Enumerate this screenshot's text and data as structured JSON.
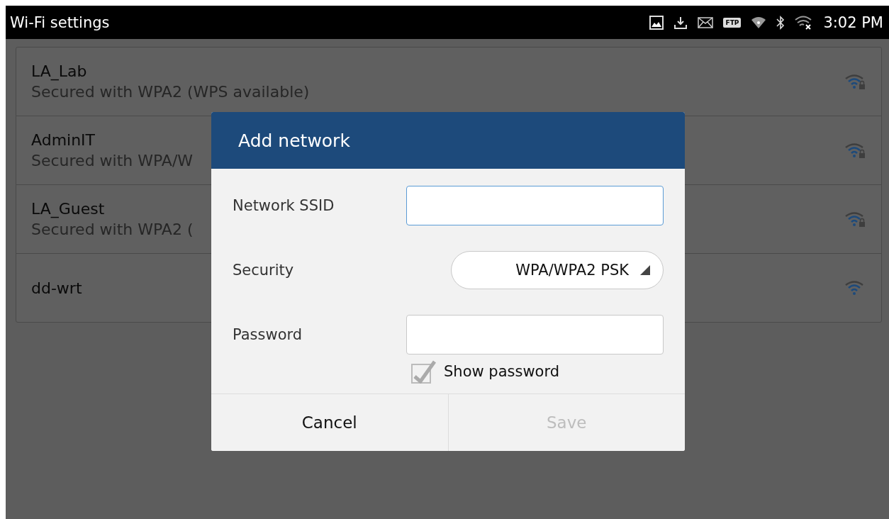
{
  "status_bar": {
    "title": "Wi-Fi settings",
    "ftp_badge": "FTP",
    "time": "3:02 PM"
  },
  "networks": [
    {
      "name": "LA_Lab",
      "detail": "Secured with WPA2 (WPS available)",
      "secured": true
    },
    {
      "name": "AdminIT",
      "detail": "Secured with WPA/W",
      "secured": true
    },
    {
      "name": "LA_Guest",
      "detail": "Secured with WPA2 (",
      "secured": true
    },
    {
      "name": "dd-wrt",
      "secured": false
    }
  ],
  "dialog": {
    "title": "Add network",
    "fields": [
      {
        "kind": "text",
        "label": "Network SSID",
        "focused": true
      },
      {
        "kind": "select",
        "label": "Security",
        "value": "WPA/WPA2 PSK"
      },
      {
        "kind": "text",
        "label": "Password",
        "focused": false
      }
    ],
    "show_password": {
      "label": "Show password",
      "checked": true
    },
    "buttons": [
      {
        "label": "Cancel",
        "disabled": false
      },
      {
        "label": "Save",
        "disabled": true
      }
    ]
  }
}
